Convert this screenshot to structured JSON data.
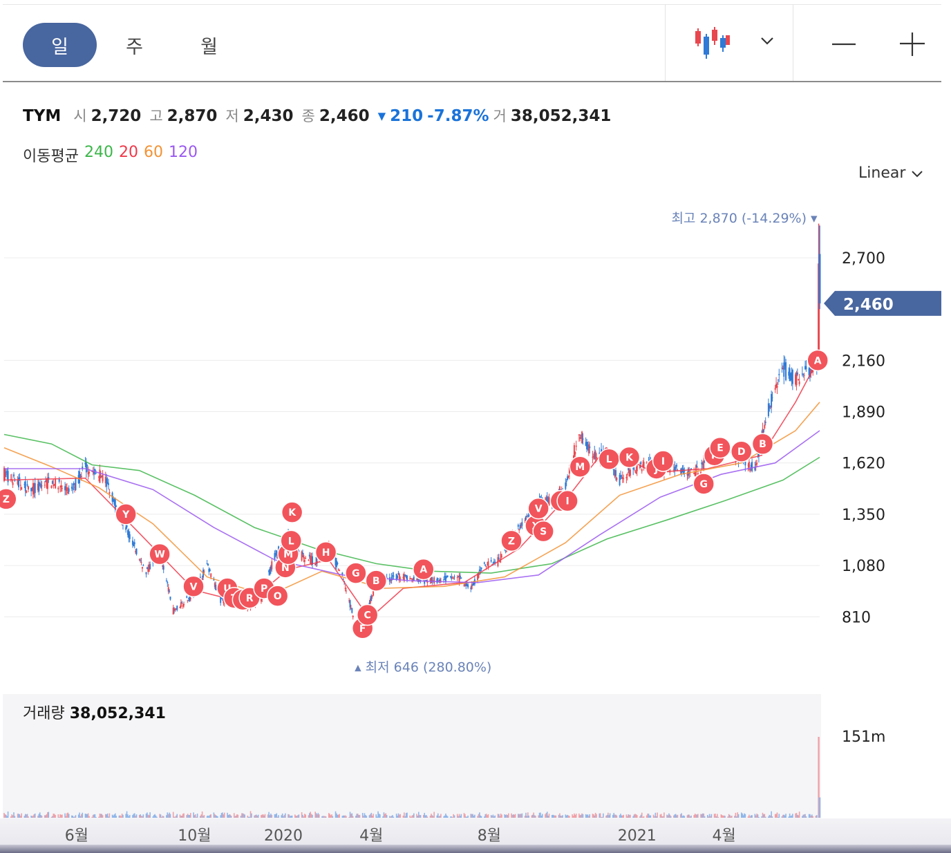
{
  "toolbar": {
    "tabs": [
      {
        "label": "일",
        "active": true
      },
      {
        "label": "주",
        "active": false
      },
      {
        "label": "월",
        "active": false
      }
    ],
    "chart_style_icon": "candlestick-icon",
    "dropdown_icon": "chevron-down-icon",
    "zoom_out_icon": "minus-icon",
    "zoom_in_icon": "plus-icon"
  },
  "quote": {
    "name": "TYM",
    "open_label": "시",
    "open": "2,720",
    "high_label": "고",
    "high": "2,870",
    "low_label": "저",
    "low": "2,430",
    "close_label": "종",
    "close": "2,460",
    "change_arrow": "▾",
    "change": "210",
    "change_pct": "-7.87%",
    "volume_label": "거",
    "volume": "38,052,341"
  },
  "moving_average": {
    "label": "이동평균",
    "periods": [
      {
        "value": "240",
        "color": "#3cb649"
      },
      {
        "value": "20",
        "color": "#f0384a"
      },
      {
        "value": "60",
        "color": "#f39234"
      },
      {
        "value": "120",
        "color": "#9a58f0"
      }
    ]
  },
  "scale_label": "Linear",
  "volume_panel": {
    "label": "거래량",
    "value": "38,052,341"
  },
  "colors": {
    "up": "#e8474f",
    "down": "#2f7ad6",
    "accent": "#48669f",
    "marker": "#f2545b"
  },
  "chart_data": {
    "type": "candlestick",
    "y_ticks": [
      "2,700",
      "2,160",
      "1,890",
      "1,620",
      "1,350",
      "1,080",
      "810"
    ],
    "y_tick_values": [
      2700,
      2160,
      1890,
      1620,
      1350,
      1080,
      810
    ],
    "ylim": [
      600,
      2900
    ],
    "x_ticks": [
      "6월",
      "10월",
      "2020",
      "4월",
      "8월",
      "2021",
      "4월"
    ],
    "x_tick_dates": [
      "2019-06-01",
      "2019-10-01",
      "2020-01-01",
      "2020-04-01",
      "2020-08-01",
      "2021-01-01",
      "2021-04-01"
    ],
    "date_range": [
      "2019-03-18",
      "2021-07-09"
    ],
    "current_price": {
      "label": "2,460",
      "value": 2460
    },
    "high_annotation": {
      "label": "최고",
      "value_text": "2,870 (-14.29%)",
      "value": 2870,
      "date": "2021-07-08"
    },
    "low_annotation": {
      "label": "최저",
      "value_text": "646 (280.80%)",
      "value": 646,
      "date": "2020-03-19"
    },
    "volume_axis_label": "151m",
    "price_path": [
      [
        "2019-03-18",
        1560
      ],
      [
        "2019-04-15",
        1480
      ],
      [
        "2019-05-06",
        1520
      ],
      [
        "2019-05-27",
        1470
      ],
      [
        "2019-06-10",
        1600
      ],
      [
        "2019-07-01",
        1530
      ],
      [
        "2019-07-15",
        1350
      ],
      [
        "2019-07-29",
        1200
      ],
      [
        "2019-08-12",
        1040
      ],
      [
        "2019-08-26",
        1160
      ],
      [
        "2019-09-09",
        840
      ],
      [
        "2019-09-30",
        930
      ],
      [
        "2019-10-14",
        1080
      ],
      [
        "2019-10-28",
        900
      ],
      [
        "2019-11-11",
        890
      ],
      [
        "2019-11-25",
        860
      ],
      [
        "2019-12-09",
        900
      ],
      [
        "2019-12-23",
        1130
      ],
      [
        "2020-01-06",
        1240
      ],
      [
        "2020-01-20",
        1130
      ],
      [
        "2020-02-03",
        1100
      ],
      [
        "2020-02-17",
        1180
      ],
      [
        "2020-03-02",
        1020
      ],
      [
        "2020-03-19",
        720
      ],
      [
        "2020-04-06",
        980
      ],
      [
        "2020-04-27",
        1020
      ],
      [
        "2020-05-18",
        1010
      ],
      [
        "2020-06-08",
        1000
      ],
      [
        "2020-06-29",
        1020
      ],
      [
        "2020-07-13",
        960
      ],
      [
        "2020-07-27",
        1080
      ],
      [
        "2020-08-10",
        1100
      ],
      [
        "2020-08-24",
        1220
      ],
      [
        "2020-09-07",
        1320
      ],
      [
        "2020-09-21",
        1410
      ],
      [
        "2020-10-05",
        1420
      ],
      [
        "2020-10-19",
        1500
      ],
      [
        "2020-11-02",
        1780
      ],
      [
        "2020-11-16",
        1660
      ],
      [
        "2020-11-30",
        1660
      ],
      [
        "2020-12-14",
        1530
      ],
      [
        "2020-12-28",
        1580
      ],
      [
        "2021-01-11",
        1620
      ],
      [
        "2021-01-25",
        1600
      ],
      [
        "2021-02-08",
        1590
      ],
      [
        "2021-02-22",
        1570
      ],
      [
        "2021-03-08",
        1590
      ],
      [
        "2021-03-22",
        1690
      ],
      [
        "2021-04-05",
        1700
      ],
      [
        "2021-04-19",
        1640
      ],
      [
        "2021-05-03",
        1590
      ],
      [
        "2021-05-17",
        1900
      ],
      [
        "2021-05-31",
        2120
      ],
      [
        "2021-06-14",
        2060
      ],
      [
        "2021-06-28",
        2100
      ],
      [
        "2021-07-07",
        2130
      ],
      [
        "2021-07-08",
        2670
      ],
      [
        "2021-07-09",
        2460
      ]
    ],
    "moving_averages": [
      {
        "name": "240",
        "color": "#3cb649",
        "points": [
          [
            "2019-03-18",
            1770
          ],
          [
            "2019-05-06",
            1720
          ],
          [
            "2019-06-17",
            1610
          ],
          [
            "2019-08-05",
            1580
          ],
          [
            "2019-10-01",
            1450
          ],
          [
            "2019-12-02",
            1280
          ],
          [
            "2020-02-03",
            1170
          ],
          [
            "2020-04-06",
            1090
          ],
          [
            "2020-06-01",
            1050
          ],
          [
            "2020-08-03",
            1040
          ],
          [
            "2020-10-05",
            1090
          ],
          [
            "2020-12-01",
            1220
          ],
          [
            "2021-02-01",
            1320
          ],
          [
            "2021-04-01",
            1420
          ],
          [
            "2021-06-01",
            1530
          ],
          [
            "2021-07-09",
            1650
          ]
        ]
      },
      {
        "name": "20",
        "color": "#f0384a",
        "points": [
          [
            "2019-03-18",
            1530
          ],
          [
            "2019-06-10",
            1540
          ],
          [
            "2019-08-05",
            1250
          ],
          [
            "2019-10-01",
            950
          ],
          [
            "2019-11-25",
            880
          ],
          [
            "2020-01-06",
            1060
          ],
          [
            "2020-02-17",
            1110
          ],
          [
            "2020-03-30",
            800
          ],
          [
            "2020-05-04",
            960
          ],
          [
            "2020-07-06",
            990
          ],
          [
            "2020-09-01",
            1170
          ],
          [
            "2020-10-26",
            1470
          ],
          [
            "2020-11-30",
            1700
          ],
          [
            "2021-01-18",
            1570
          ],
          [
            "2021-03-15",
            1590
          ],
          [
            "2021-05-10",
            1660
          ],
          [
            "2021-06-14",
            1940
          ],
          [
            "2021-07-09",
            2180
          ]
        ]
      },
      {
        "name": "60",
        "color": "#f39234",
        "points": [
          [
            "2019-03-18",
            1700
          ],
          [
            "2019-05-06",
            1600
          ],
          [
            "2019-06-24",
            1490
          ],
          [
            "2019-08-19",
            1300
          ],
          [
            "2019-10-14",
            1020
          ],
          [
            "2019-12-16",
            920
          ],
          [
            "2020-02-10",
            1050
          ],
          [
            "2020-04-13",
            960
          ],
          [
            "2020-06-15",
            970
          ],
          [
            "2020-08-17",
            1020
          ],
          [
            "2020-10-19",
            1200
          ],
          [
            "2020-12-14",
            1450
          ],
          [
            "2021-02-15",
            1560
          ],
          [
            "2021-04-19",
            1620
          ],
          [
            "2021-06-14",
            1790
          ],
          [
            "2021-07-09",
            1940
          ]
        ]
      },
      {
        "name": "120",
        "color": "#9a58f0",
        "points": [
          [
            "2019-03-18",
            1590
          ],
          [
            "2019-06-10",
            1590
          ],
          [
            "2019-08-19",
            1480
          ],
          [
            "2019-10-21",
            1280
          ],
          [
            "2019-12-23",
            1110
          ],
          [
            "2020-03-02",
            1030
          ],
          [
            "2020-05-11",
            1000
          ],
          [
            "2020-07-20",
            990
          ],
          [
            "2020-09-21",
            1030
          ],
          [
            "2020-11-23",
            1240
          ],
          [
            "2021-01-25",
            1440
          ],
          [
            "2021-03-29",
            1560
          ],
          [
            "2021-05-24",
            1620
          ],
          [
            "2021-07-09",
            1790
          ]
        ]
      }
    ],
    "event_markers": [
      {
        "label": "Z",
        "date": "2019-03-20",
        "value": 1430
      },
      {
        "label": "Y",
        "date": "2019-07-22",
        "value": 1350
      },
      {
        "label": "W",
        "date": "2019-08-26",
        "value": 1140
      },
      {
        "label": "V",
        "date": "2019-09-30",
        "value": 970
      },
      {
        "label": "U",
        "date": "2019-11-04",
        "value": 960
      },
      {
        "label": "T",
        "date": "2019-11-11",
        "value": 910
      },
      {
        "label": "S",
        "date": "2019-11-20",
        "value": 900
      },
      {
        "label": "R",
        "date": "2019-11-27",
        "value": 910
      },
      {
        "label": "P",
        "date": "2019-12-12",
        "value": 960
      },
      {
        "label": "O",
        "date": "2019-12-26",
        "value": 920
      },
      {
        "label": "N",
        "date": "2020-01-03",
        "value": 1070
      },
      {
        "label": "M",
        "date": "2020-01-06",
        "value": 1140
      },
      {
        "label": "L",
        "date": "2020-01-09",
        "value": 1210
      },
      {
        "label": "K",
        "date": "2020-01-10",
        "value": 1360
      },
      {
        "label": "H",
        "date": "2020-02-14",
        "value": 1150
      },
      {
        "label": "G",
        "date": "2020-03-16",
        "value": 1040
      },
      {
        "label": "F",
        "date": "2020-03-23",
        "value": 750
      },
      {
        "label": "C",
        "date": "2020-03-28",
        "value": 820
      },
      {
        "label": "B",
        "date": "2020-04-06",
        "value": 1000
      },
      {
        "label": "A",
        "date": "2020-05-25",
        "value": 1060
      },
      {
        "label": "Z",
        "date": "2020-08-24",
        "value": 1210
      },
      {
        "label": "X",
        "date": "2020-09-18",
        "value": 1290
      },
      {
        "label": "V",
        "date": "2020-09-21",
        "value": 1380
      },
      {
        "label": "S",
        "date": "2020-09-26",
        "value": 1260
      },
      {
        "label": "Q",
        "date": "2020-10-14",
        "value": 1420
      },
      {
        "label": "I",
        "date": "2020-10-21",
        "value": 1420
      },
      {
        "label": "M",
        "date": "2020-11-03",
        "value": 1600
      },
      {
        "label": "L",
        "date": "2020-12-03",
        "value": 1640
      },
      {
        "label": "K",
        "date": "2020-12-24",
        "value": 1650
      },
      {
        "label": "J",
        "date": "2021-01-21",
        "value": 1590
      },
      {
        "label": "I",
        "date": "2021-01-28",
        "value": 1630
      },
      {
        "label": "G",
        "date": "2021-03-11",
        "value": 1510
      },
      {
        "label": "F",
        "date": "2021-03-22",
        "value": 1660
      },
      {
        "label": "E",
        "date": "2021-03-28",
        "value": 1700
      },
      {
        "label": "D",
        "date": "2021-04-19",
        "value": 1680
      },
      {
        "label": "B",
        "date": "2021-05-11",
        "value": 1720
      },
      {
        "label": "A",
        "date": "2021-07-07",
        "value": 2160
      }
    ]
  }
}
